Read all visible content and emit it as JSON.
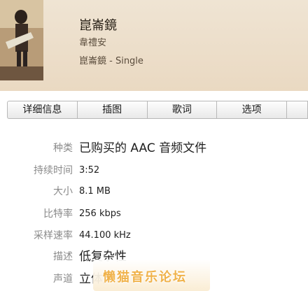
{
  "header": {
    "title": "崑崙鏡",
    "artist": "韋禮安",
    "album": "崑崙鏡 - Single"
  },
  "tabs": [
    {
      "label": "详细信息"
    },
    {
      "label": "插图"
    },
    {
      "label": "歌词"
    },
    {
      "label": "选项"
    },
    {
      "label": ""
    }
  ],
  "details": [
    {
      "label": "种类",
      "value": "已购买的 AAC 音频文件"
    },
    {
      "label": "持续时间",
      "value": "3:52"
    },
    {
      "label": "大小",
      "value": "8.1 MB"
    },
    {
      "label": "比特率",
      "value": "256 kbps"
    },
    {
      "label": "采样速率",
      "value": "44.100 kHz"
    },
    {
      "label": "描述",
      "value": "低复杂性"
    },
    {
      "label": "声道",
      "value": "立体声"
    }
  ],
  "watermark": {
    "text": "懒猫音乐论坛"
  },
  "colors": {
    "header_bg": "#ecdcc6",
    "label": "#8a8a8a",
    "watermark": "#f0b24a"
  }
}
